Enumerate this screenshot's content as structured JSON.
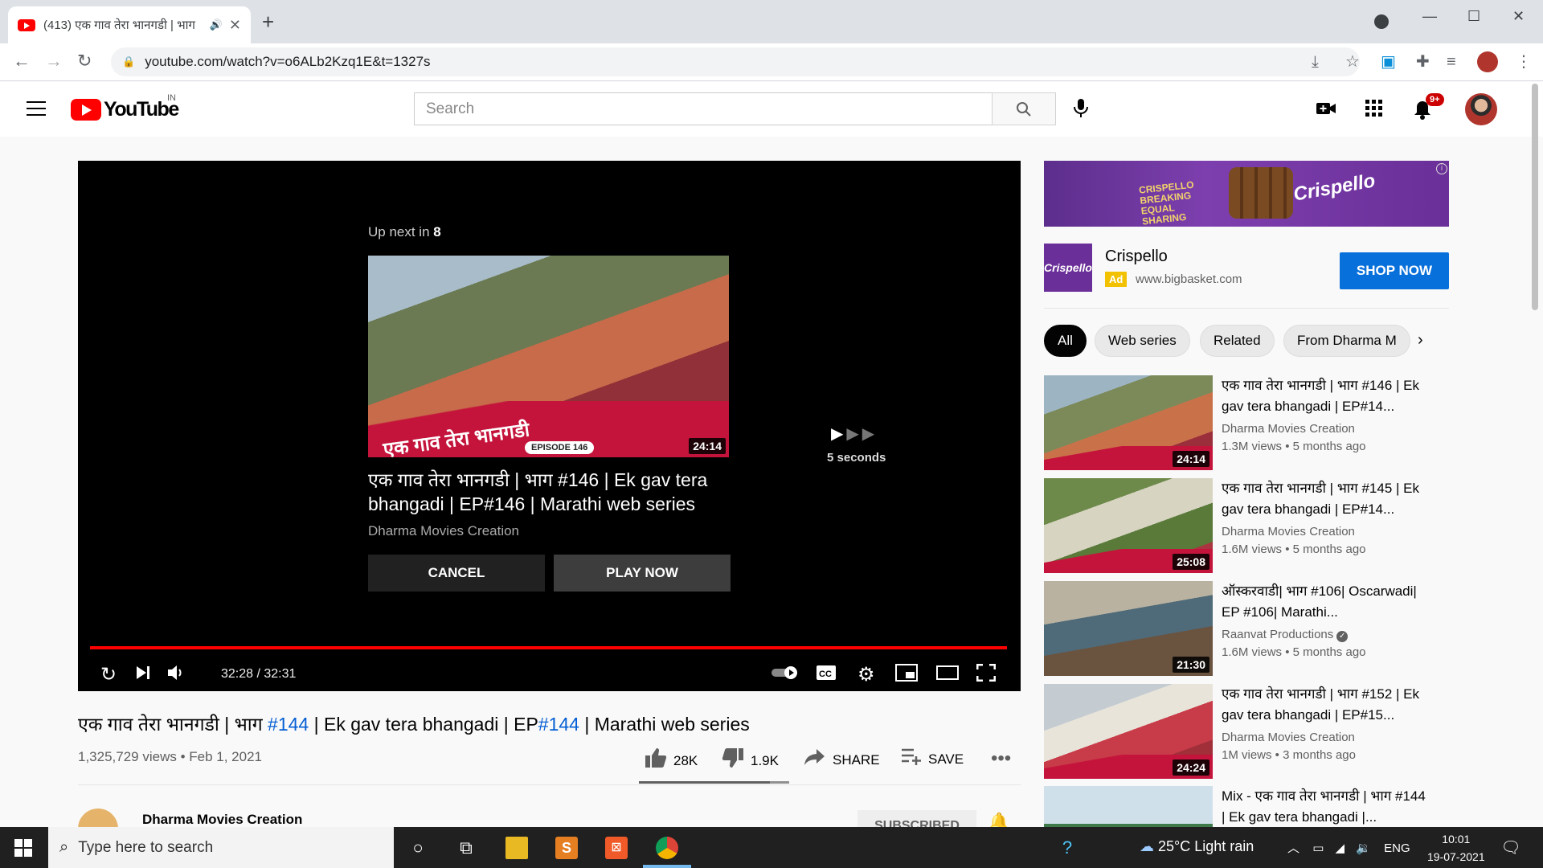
{
  "browser": {
    "tab_title": "(413) एक गाव तेरा भानगडी | भाग",
    "url": "youtube.com/watch?v=o6ALb2Kzq1E&t=1327s"
  },
  "header": {
    "logo_text": "YouTube",
    "country_code": "IN",
    "search_placeholder": "Search",
    "notification_count": "9+"
  },
  "player": {
    "up_next_prefix": "Up next in ",
    "up_next_count": "8",
    "up_next_duration": "24:14",
    "up_next_episode": "EPISODE 146",
    "up_next_thumb_text": "एक गाव तेरा भानगडी",
    "up_next_title": "एक गाव तेरा भानगडी | भाग #146 | Ek gav tera bhangadi | EP#146 | Marathi web series",
    "up_next_channel": "Dharma Movies Creation",
    "cancel_label": "CANCEL",
    "play_now_label": "PLAY NOW",
    "autoplay_countdown": "5 seconds",
    "time_display": "32:28 / 32:31",
    "progress": 0.998
  },
  "video": {
    "title_part1": "एक गाव तेरा भानगडी | भाग ",
    "title_tag1": "#144",
    "title_part2": " | Ek gav tera bhangadi | EP",
    "title_tag2": "#144",
    "title_part3": " | Marathi web series",
    "meta": "1,325,729 views • Feb 1, 2021",
    "likes": "28K",
    "dislikes": "1.9K",
    "share_label": "SHARE",
    "save_label": "SAVE",
    "like_ratio": 0.87,
    "channel_name": "Dharma Movies Creation",
    "subscribed_label": "SUBSCRIBED"
  },
  "ad": {
    "banner_line1": "CRISPELLO BREAKING EQUAL SHARING",
    "banner_brand": "Crispello",
    "brand_name": "Crispello",
    "badge": "Ad",
    "url": "www.bigbasket.com",
    "cta": "SHOP NOW"
  },
  "chips": [
    "All",
    "Web series",
    "Related",
    "From Dharma M"
  ],
  "recommendations": [
    {
      "title": "एक गाव तेरा भानगडी | भाग #146 | Ek gav tera bhangadi | EP#14...",
      "channel": "Dharma Movies Creation",
      "meta": "1.3M views • 5 months ago",
      "duration": "24:14",
      "verified": false
    },
    {
      "title": "एक गाव तेरा भानगडी | भाग #145 | Ek gav tera bhangadi | EP#14...",
      "channel": "Dharma Movies Creation",
      "meta": "1.6M views • 5 months ago",
      "duration": "25:08",
      "verified": false
    },
    {
      "title": "ऑस्करवाडी| भाग #106| Oscarwadi| EP #106| Marathi...",
      "channel": "Raanvat Productions",
      "meta": "1.6M views • 5 months ago",
      "duration": "21:30",
      "verified": true
    },
    {
      "title": "एक गाव तेरा भानगडी | भाग #152 | Ek gav tera bhangadi | EP#15...",
      "channel": "Dharma Movies Creation",
      "meta": "1M views • 3 months ago",
      "duration": "24:24",
      "verified": false
    },
    {
      "title": "Mix - एक गाव तेरा भानगडी | भाग #144 | Ek gav tera bhangadi |...",
      "channel": "",
      "meta": "",
      "duration": "",
      "verified": false
    }
  ],
  "taskbar": {
    "search_placeholder": "Type here to search",
    "weather": "25°C  Light rain",
    "language": "ENG",
    "time": "10:01",
    "date": "19-07-2021"
  },
  "colors": {
    "youtube_red": "#ff0000",
    "link_blue": "#065fd4",
    "shop_button": "#0870db",
    "ad_purple": "#6a2f98"
  }
}
